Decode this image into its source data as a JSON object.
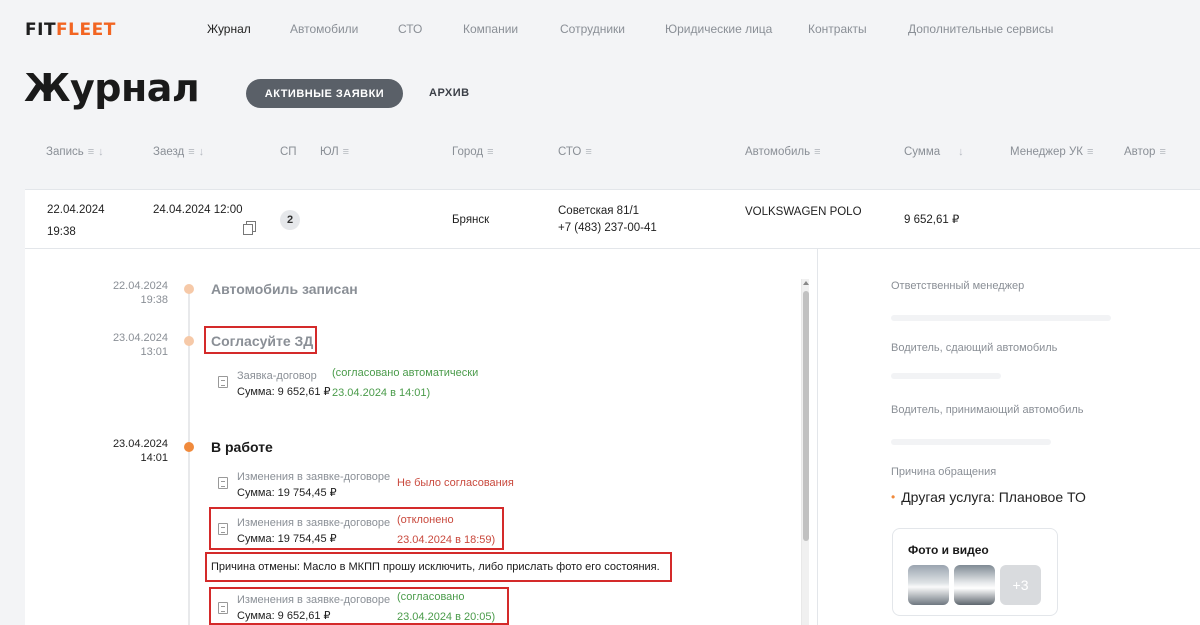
{
  "logo": {
    "fit": "FIT",
    "fleet": "FLEET"
  },
  "nav": [
    {
      "label": "Журнал",
      "active": true
    },
    {
      "label": "Автомобили",
      "active": false
    },
    {
      "label": "СТО",
      "active": false
    },
    {
      "label": "Компании",
      "active": false
    },
    {
      "label": "Сотрудники",
      "active": false
    },
    {
      "label": "Юридические лица",
      "active": false
    },
    {
      "label": "Контракты",
      "active": false
    },
    {
      "label": "Дополнительные сервисы",
      "active": false
    }
  ],
  "page": {
    "title": "Журнал"
  },
  "tabs": {
    "active": "АКТИВНЫЕ ЗАЯВКИ",
    "archive": "АРХИВ"
  },
  "table": {
    "headers": [
      "Запись",
      "Заезд",
      "СП",
      "ЮЛ",
      "Город",
      "СТО",
      "Автомобиль",
      "Сумма",
      "Менеджер УК",
      "Автор"
    ],
    "row": {
      "record_date": "22.04.2024",
      "record_time": "19:38",
      "arrival": "24.04.2024 12:00",
      "sp": "2",
      "city": "Брянск",
      "sto_address": "Советская 81/1",
      "sto_phone": "+7 (483) 237-00-41",
      "car": "VOLKSWAGEN POLO",
      "sum": "9 652,61 ₽"
    }
  },
  "timeline": {
    "e1": {
      "date": "22.04.2024",
      "time": "19:38",
      "title": "Автомобиль записан"
    },
    "e2": {
      "date": "23.04.2024",
      "time": "13:01",
      "title": "Согласуйте ЗД"
    },
    "e2_doc": {
      "title": "Заявка-договор",
      "sum": "Сумма: 9 652,61 ₽",
      "status1": "(согласовано автоматически",
      "status2": "23.04.2024 в 14:01)"
    },
    "e3": {
      "date": "23.04.2024",
      "time": "14:01",
      "title": "В работе"
    },
    "e3_doc1": {
      "title": "Изменения в заявке-договоре",
      "sum": "Сумма: 19 754,45 ₽",
      "status": "Не было согласования"
    },
    "e3_doc2": {
      "title": "Изменения в заявке-договоре",
      "sum": "Сумма: 19 754,45 ₽",
      "status1": "(отклонено",
      "status2": "23.04.2024 в 18:59)"
    },
    "reason": "Причина отмены: Масло в МКПП прошу исключить, либо прислать фото его состояния.",
    "e3_doc3": {
      "title": "Изменения в заявке-договоре",
      "sum": "Сумма: 9 652,61 ₽",
      "status1": "(согласовано",
      "status2": "23.04.2024 в 20:05)"
    }
  },
  "side": {
    "manager_label": "Ответственный менеджер",
    "driver_out_label": "Водитель, сдающий автомобиль",
    "driver_in_label": "Водитель, принимающий автомобиль",
    "reason_label": "Причина обращения",
    "reason_value": "Другая услуга: Плановое ТО",
    "media_title": "Фото и видео",
    "media_more": "+3"
  },
  "colors": {
    "accent": "#f26522",
    "tab_active_bg": "#5a6068",
    "green": "#4a9b4a",
    "red": "#c9493d",
    "highlight_box": "#d42a2a"
  }
}
